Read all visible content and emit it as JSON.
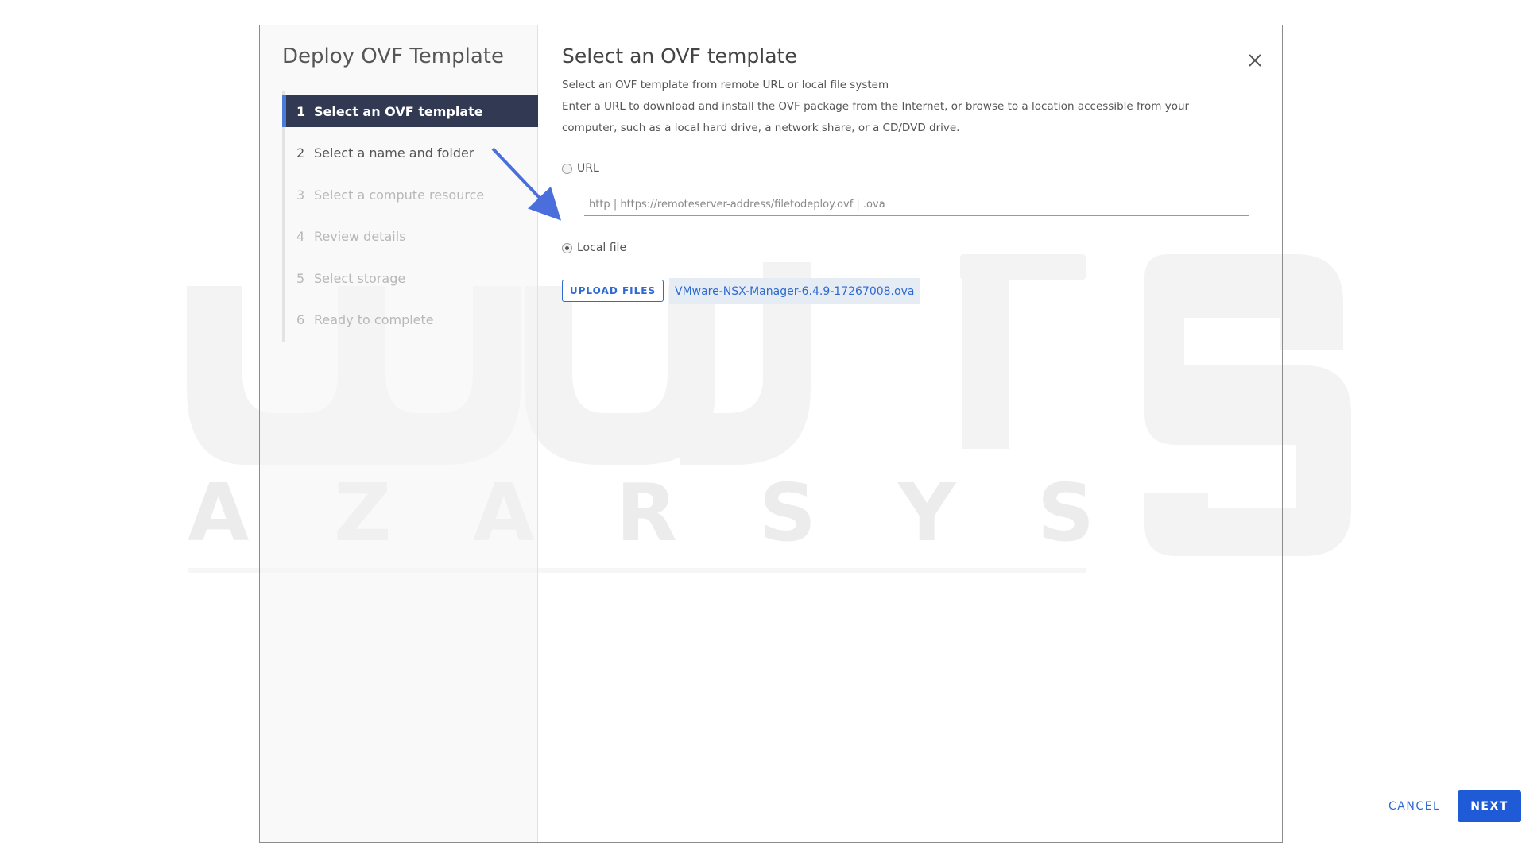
{
  "sidebar": {
    "title": "Deploy OVF Template",
    "steps": [
      {
        "num": "1",
        "label": "Select an OVF template"
      },
      {
        "num": "2",
        "label": "Select a name and folder"
      },
      {
        "num": "3",
        "label": "Select a compute resource"
      },
      {
        "num": "4",
        "label": "Review details"
      },
      {
        "num": "5",
        "label": "Select storage"
      },
      {
        "num": "6",
        "label": "Ready to complete"
      }
    ]
  },
  "main": {
    "title": "Select an OVF template",
    "description_1": "Select an OVF template from remote URL or local file system",
    "description_2": "Enter a URL to download and install the OVF package from the Internet, or browse to a location accessible from your computer, such as a local hard drive, a network share, or a CD/DVD drive.",
    "url_option_label": "URL",
    "url_placeholder": "http | https://remoteserver-address/filetodeploy.ovf | .ova",
    "url_value": "",
    "local_option_label": "Local file",
    "selected_option": "Local file",
    "upload_button_label": "UPLOAD FILES",
    "selected_file": "VMware-NSX-Manager-6.4.9-17267008.ova"
  },
  "footer": {
    "cancel_label": "CANCEL",
    "next_label": "NEXT"
  },
  "watermark": {
    "brand_latin": "AZARSYS"
  },
  "icons": {
    "close": "close-icon",
    "annotation": "arrow-annotation"
  },
  "colors": {
    "accent": "#2f6ad0",
    "primary_button": "#1f5bd6",
    "active_step_bg": "#313a52",
    "annotation_arrow": "#4a6fdc"
  }
}
